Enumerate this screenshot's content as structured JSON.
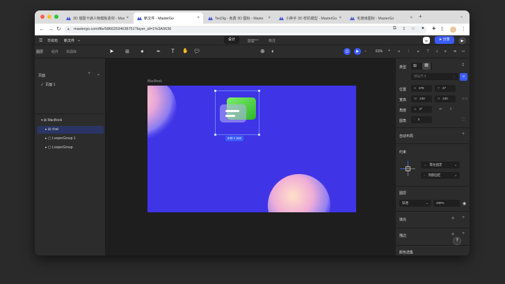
{
  "tabs": [
    {
      "title": "3D 插图卡通人物模板素材 - Mas",
      "color": "#4a5bd6",
      "active": false
    },
    {
      "title": "新文件 - MasterGo",
      "color": "#4a5bd6",
      "active": true
    },
    {
      "title": "TecDig - 免费 3D 图标 - Maste",
      "color": "#4a5bd6",
      "active": false
    },
    {
      "title": "小胖手 3D 样机模型 - MasterGo",
      "color": "#4a5bd6",
      "active": false
    },
    {
      "title": "毛玻璃图标 - MasterGo",
      "color": "#4a5bd6",
      "active": false
    }
  ],
  "address": {
    "url": "mastergo.com/file/58662534638751?layer_id=1%3A0636"
  },
  "topbar": {
    "draft": "草稿箱",
    "file": "新文件",
    "mode_design": "设计",
    "mode_proto": "原型",
    "mode_proto_badge": "beta",
    "mode_annot": "标注",
    "share": "分享",
    "zoom": "61%"
  },
  "left_panel": {
    "tabs": [
      "图层",
      "组件",
      "资源库"
    ],
    "pages_title": "页面",
    "pages": [
      "页面 1"
    ],
    "layers": [
      "MacBook",
      "chat",
      "LooperGroup 1",
      "LooperGroup"
    ]
  },
  "canvas": {
    "frame_name": "MacBook",
    "size_label": "240 × 240"
  },
  "right_panel": {
    "type_label": "类型",
    "preset_placeholder": "预设尺寸",
    "position_label": "位置",
    "x_key": "X",
    "x": "378",
    "y_key": "Y",
    "y": "27",
    "size_label": "宽高",
    "w_key": "W",
    "w": "240",
    "h_key": "H",
    "h": "240",
    "rotation_label": "角度",
    "rotation": "0°",
    "radius_label": "圆角",
    "radius": "0",
    "autolayout_label": "自动布局",
    "constraint_label": "约束",
    "constraint_h": "靠左固定",
    "constraint_v": "顶部固定",
    "layer_label": "图层",
    "blend": "穿透",
    "opacity": "100%",
    "fill_label": "填充",
    "stroke_label": "描边",
    "color_sel_label": "颜色选集",
    "help": "?"
  },
  "colors": {
    "accent": "#3b5bfd",
    "frame": "#3f34e6",
    "green": "#3ec53a"
  }
}
